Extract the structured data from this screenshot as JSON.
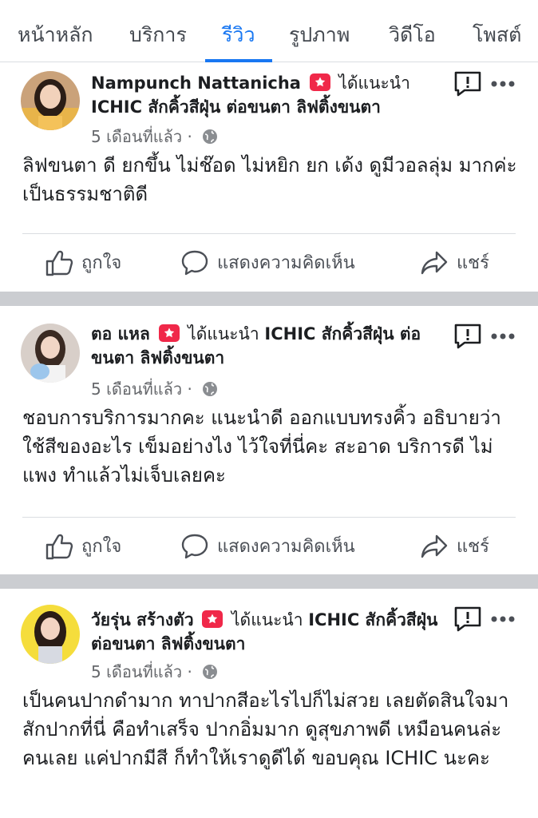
{
  "tabs": [
    {
      "label": "หน้าหลัก",
      "active": false
    },
    {
      "label": "บริการ",
      "active": false
    },
    {
      "label": "รีวิว",
      "active": true
    },
    {
      "label": "รูปภาพ",
      "active": false
    },
    {
      "label": "วิดีโอ",
      "active": false
    },
    {
      "label": "โพสต์",
      "active": false
    }
  ],
  "colors": {
    "accent": "#1877f2",
    "recommend_badge": "#f02849",
    "separator": "#cbcdd1",
    "muted_text": "#65676b"
  },
  "actions": {
    "like": "ถูกใจ",
    "comment": "แสดงความคิดเห็น",
    "share": "แชร์"
  },
  "posts": [
    {
      "author": "Nampunch Nattanicha",
      "recommends": "ได้แนะนำ",
      "page": "ICHIC สักคิ้วสีฝุ่น ต่อขนตา ลิฟติ้งขนตา",
      "time": "5 เดือนที่แล้ว ·",
      "text": "ลิฟขนตา ดี ยกขึ้น  ไม่ช๊อด ไม่หยิก ยก เด้ง ดูมีวอลลุ่ม มากค่ะ เป็นธรรมชาติดี"
    },
    {
      "author": "ตอ แหล",
      "recommends": "ได้แนะนำ",
      "page": "ICHIC สักคิ้วสีฝุ่น ต่อขนตา ลิฟติ้งขนตา",
      "time": "5 เดือนที่แล้ว ·",
      "text": "ชอบการบริการมากคะ แนะนำดี ออกแบบทรงคิ้ว อธิบายว่าใช้สีของอะไร เข็มอย่างไง ไว้ใจที่นี่คะ สะอาด บริการดี  ไม่แพง ทำแล้วไม่เจ็บเลยคะ"
    },
    {
      "author": "วัยรุ่น สร้างตัว",
      "recommends": "ได้แนะนำ",
      "page": "ICHIC สักคิ้วสีฝุ่น ต่อขนตา ลิฟติ้งขนตา",
      "time": "5 เดือนที่แล้ว ·",
      "text": "เป็นคนปากดำมาก ทาปากสีอะไรไปก็ไม่สวย เลยตัดสินใจมาสักปากที่นี่ คือทำเสร็จ ปากอิ่มมาก ดูสุขภาพดี เหมือนคนล่ะคนเลย  แค่ปากมีสี  ก็ทำให้เราดูดีได้ ขอบคุณ ICHIC  นะคะ"
    }
  ]
}
